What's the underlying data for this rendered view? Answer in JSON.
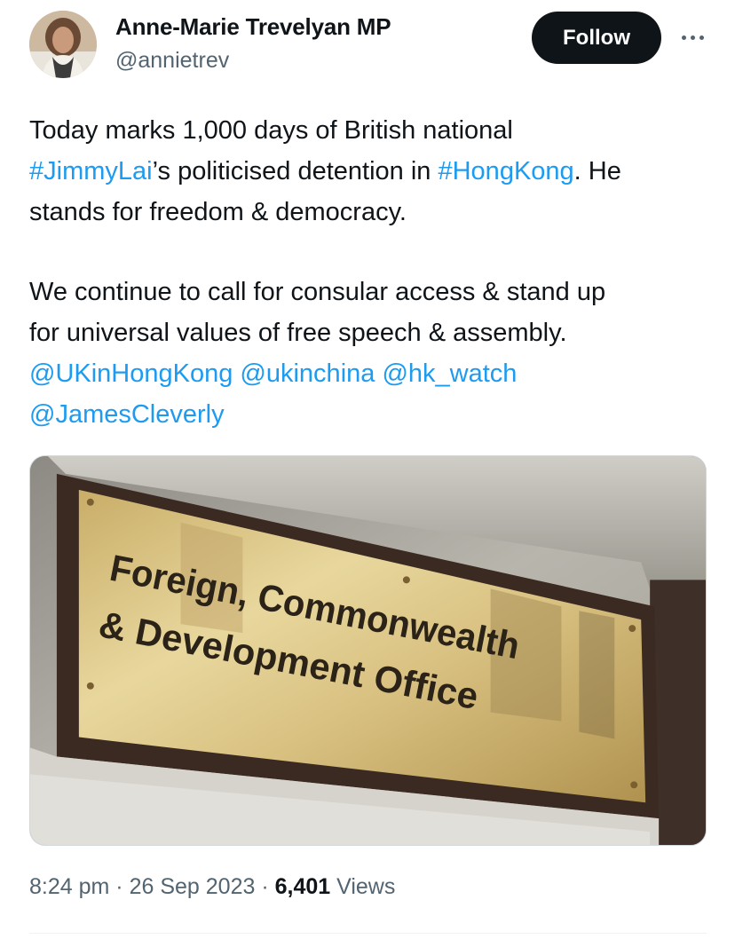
{
  "author": {
    "name": "Anne-Marie Trevelyan MP",
    "handle": "@annietrev"
  },
  "actions": {
    "follow_label": "Follow",
    "more_icon": "more-horizontal-icon"
  },
  "tweet": {
    "line1": "Today marks 1,000 days of British national",
    "hashtag1": "#JimmyLai",
    "line2_mid": "’s politicised detention in ",
    "hashtag2": "#HongKong",
    "line2_end": ". He",
    "line3": "stands for freedom & democracy.",
    "line4": "We continue to call for consular access & stand up",
    "line5": "for universal values of free speech & assembly.",
    "mention1": "@UKinHongKong",
    "mention2": "@ukinchina",
    "mention3": "@hk_watch",
    "mention4": "@JamesCleverly"
  },
  "media": {
    "sign_line1": "Foreign, Commonwealth",
    "sign_line2": "& Development Office"
  },
  "meta": {
    "time": "8:24 pm",
    "separator": "·",
    "date": "26 Sep 2023",
    "views_count": "6,401",
    "views_label": "Views"
  },
  "colors": {
    "link": "#1d9bf0",
    "secondary_text": "#536471",
    "follow_button_bg": "#0f1419"
  }
}
